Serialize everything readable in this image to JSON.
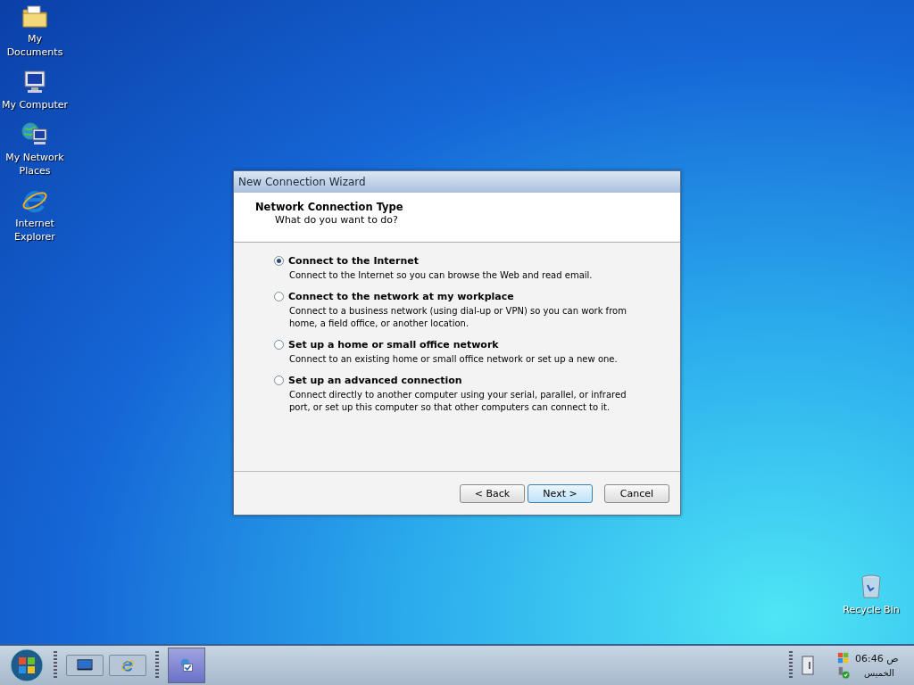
{
  "desktop_icons": [
    {
      "kind": "documents",
      "label": "My Documents"
    },
    {
      "kind": "computer",
      "label": "My Computer"
    },
    {
      "kind": "network",
      "label": "My Network Places"
    },
    {
      "kind": "browser",
      "label": "Internet Explorer"
    }
  ],
  "recycle_bin": {
    "label": "Recycle Bin"
  },
  "window": {
    "title": "New Connection Wizard",
    "heading": "Network Connection Type",
    "subheading": "What do you want to do?",
    "options": [
      {
        "label": "Connect to the Internet",
        "description": "Connect to the Internet so you can browse the Web and read email.",
        "selected": true
      },
      {
        "label": "Connect to the network at my workplace",
        "description": "Connect to a business network (using dial-up or VPN) so you can work from home, a field office, or another location.",
        "selected": false
      },
      {
        "label": "Set up a home or small office network",
        "description": "Connect to an existing home or small office network or set up a new one.",
        "selected": false
      },
      {
        "label": "Set up an advanced connection",
        "description": "Connect directly to another computer using your serial, parallel, or infrared port, or set up this computer so that other computers can connect to it.",
        "selected": false
      }
    ],
    "buttons": [
      {
        "label": "< Back",
        "default": false
      },
      {
        "label": "Next >",
        "default": true
      },
      {
        "label": "Cancel",
        "default": false
      }
    ]
  },
  "taskbar": {
    "quick_launch": [
      {
        "kind": "desktop"
      },
      {
        "kind": "browser"
      }
    ],
    "tasks": [
      {
        "kind": "wizard",
        "selected": true
      }
    ],
    "clock": "06:46 ص",
    "day": "الخميس"
  }
}
